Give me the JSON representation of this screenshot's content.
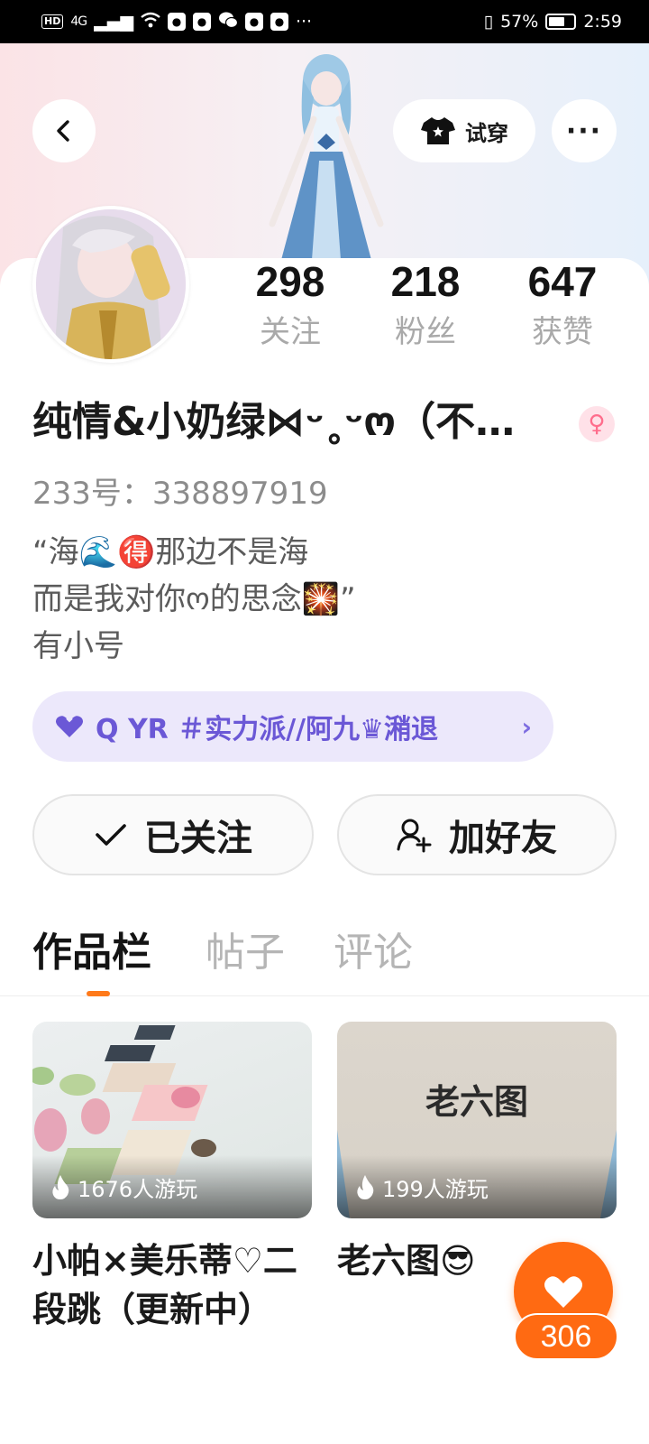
{
  "status_bar": {
    "hd": "HD",
    "network": "4G",
    "more": "···",
    "battery": "57%",
    "time": "2:59"
  },
  "header": {
    "try_on_label": "试穿",
    "more_label": "···"
  },
  "profile": {
    "stats": [
      {
        "value": "298",
        "label": "关注"
      },
      {
        "value": "218",
        "label": "粉丝"
      },
      {
        "value": "647",
        "label": "获赞"
      }
    ],
    "username": "纯情&小奶绿⋈ᵕ˳ᵕო（不…",
    "gender_symbol": "♀",
    "uid": "233号：338897919",
    "bio": [
      "“海🌊🉐那边不是海",
      "而是我对你ო的思念🎇”",
      "有小号"
    ],
    "tag_text": "Q YR ＃实力派//阿九♛潲退",
    "tag_chevron": "›"
  },
  "actions": {
    "follow_label": "已关注",
    "add_friend_label": "加好友"
  },
  "tabs": [
    {
      "label": "作品栏",
      "active": true
    },
    {
      "label": "帖子",
      "active": false
    },
    {
      "label": "评论",
      "active": false
    }
  ],
  "works": [
    {
      "plays": "1676人游玩",
      "title": "小帕×美乐蒂♡二段跳（更新中）"
    },
    {
      "plays": "199人游玩",
      "title": "老六图😎",
      "thumb_text": "老六图"
    }
  ],
  "like_fab": {
    "count": "306"
  },
  "colors": {
    "accent": "#ff6a12",
    "tag_bg": "#ece8fb",
    "tag_text": "#6b58d6",
    "gender_pink": "#ff6d8c"
  }
}
